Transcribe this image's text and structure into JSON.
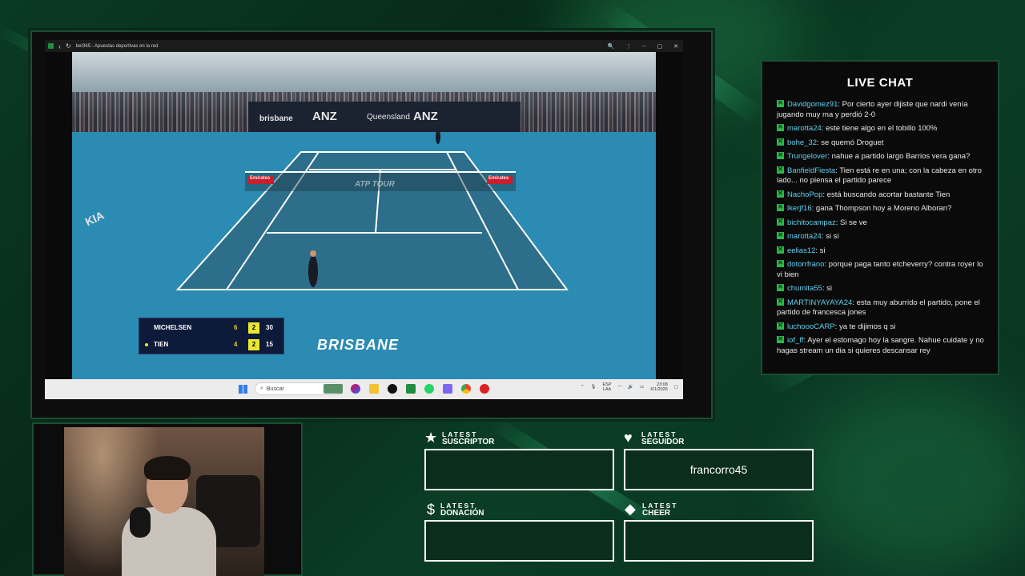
{
  "browser": {
    "tab_title": "bet365 - Apuestas deportivas en la red",
    "controls": [
      "‹",
      "↻"
    ],
    "right_icons": [
      "🔍",
      "⋮",
      "–",
      "▢",
      "✕"
    ]
  },
  "video": {
    "scoreboard": {
      "players": [
        {
          "name": "MICHELSEN",
          "set": "6",
          "game": "2",
          "points": "30",
          "serving": false
        },
        {
          "name": "TIEN",
          "set": "4",
          "game": "2",
          "points": "15",
          "serving": true
        }
      ]
    },
    "location": "BRISBANE",
    "sponsors": [
      "brisbane",
      "ANZ",
      "Queensland",
      "ANZ",
      "ATP TOUR",
      "Emirates",
      "Emirates",
      "KIA"
    ]
  },
  "taskbar": {
    "search_placeholder": "Buscar",
    "tray_lang_1": "ESP",
    "tray_lang_2": "LAA",
    "tray_time": "23:08",
    "tray_date": "6/1/2026"
  },
  "chat": {
    "title": "LIVE CHAT",
    "messages": [
      {
        "user": "Davidgomez91",
        "text": "Por cierto ayer dijiste que nardi venía jugando muy ma y perdió 2-0"
      },
      {
        "user": "marotta24",
        "text": "este tiene algo en el tobillo 100%"
      },
      {
        "user": "bohe_32",
        "text": "se quemó Droguet"
      },
      {
        "user": "Trungelover",
        "text": "nahue a partido largo Barrios vera gana?"
      },
      {
        "user": "BanfieldFiesta",
        "text": "Tien está re en una; con la cabeza en otro lado... no piensa el partido parece"
      },
      {
        "user": "NachoPop",
        "text": "está buscando acortar bastante Tien"
      },
      {
        "user": "lkerjf16",
        "text": "gana Thompson hoy a Moreno Alboran?"
      },
      {
        "user": "bichitocampaz",
        "text": "Si se ve"
      },
      {
        "user": "marotta24",
        "text": "si si"
      },
      {
        "user": "eelias12",
        "text": "si"
      },
      {
        "user": "dotorrfrano",
        "text": "porque paga tanto etcheverry? contra royer lo vi bien"
      },
      {
        "user": "chumita55",
        "text": "si"
      },
      {
        "user": "MARTINYAYAYA24",
        "text": "esta muy aburrido el partido, pone el partido de francesca jones"
      },
      {
        "user": "luchoooCARP",
        "text": "ya te dijimos q si"
      },
      {
        "user": "iof_ff",
        "text": "Ayer el estomago hoy la sangre. Nahue cuidate y no hagas stream un dia si quieres descansar rey"
      }
    ]
  },
  "alerts": {
    "suscriptor": {
      "latest": "LATEST",
      "label": "SUSCRIPTOR",
      "icon": "★",
      "value": ""
    },
    "seguidor": {
      "latest": "LATEST",
      "label": "SEGUIDOR",
      "icon": "♥",
      "value": "francorro45"
    },
    "donacion": {
      "latest": "LATEST",
      "label": "DONACIÓN",
      "icon": "$",
      "value": ""
    },
    "cheer": {
      "latest": "LATEST",
      "label": "CHEER",
      "icon": "◆",
      "value": ""
    }
  }
}
